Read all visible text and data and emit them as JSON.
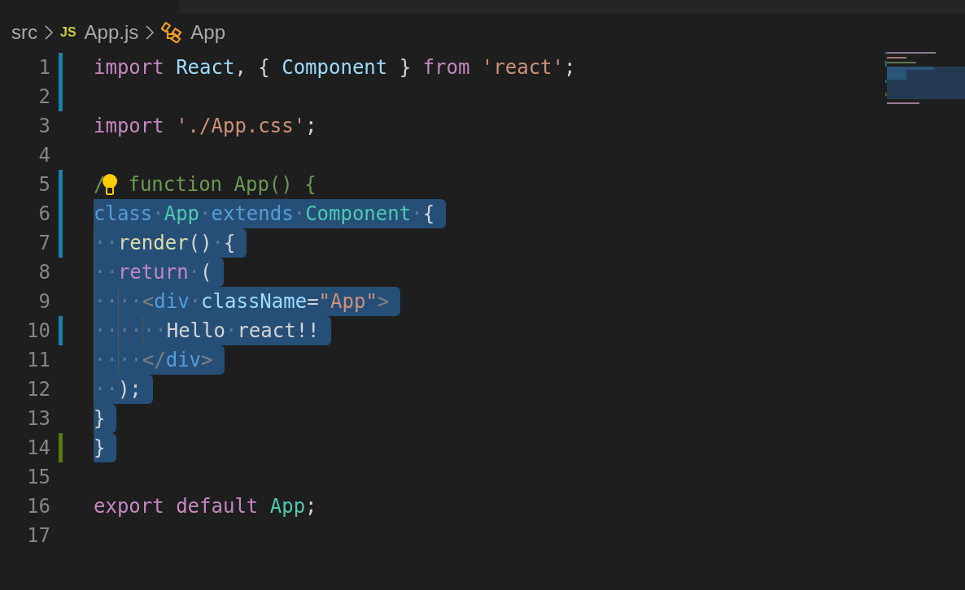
{
  "breadcrumb": [
    {
      "kind": "folder",
      "label": "src"
    },
    {
      "kind": "js-file",
      "badge": "JS",
      "label": "App.js"
    },
    {
      "kind": "symbol",
      "label": "App"
    }
  ],
  "lines": [
    {
      "number": "1",
      "kind": "modified",
      "selected": false,
      "tokens": [
        {
          "t": "import ",
          "kind": "control"
        },
        {
          "t": "React",
          "kind": "variable"
        },
        {
          "t": ", { ",
          "kind": "punct"
        },
        {
          "t": "Component",
          "kind": "variable"
        },
        {
          "t": " } ",
          "kind": "punct"
        },
        {
          "t": "from ",
          "kind": "control"
        },
        {
          "t": "'react'",
          "kind": "string"
        },
        {
          "t": ";",
          "kind": "punct"
        }
      ]
    },
    {
      "number": "2",
      "kind": "modified",
      "selected": false
    },
    {
      "number": "3",
      "kind": "plain",
      "selected": false,
      "tokens": [
        {
          "t": "import ",
          "kind": "control"
        },
        {
          "t": "'./App.css'",
          "kind": "string"
        },
        {
          "t": ";",
          "kind": "punct"
        }
      ]
    },
    {
      "number": "4",
      "kind": "plain",
      "selected": false
    },
    {
      "number": "5",
      "kind": "modified",
      "selected": false,
      "tokens": [
        {
          "t": "/",
          "kind": "comment"
        },
        {
          "kind": "bulb"
        },
        {
          "t": "function App() {",
          "kind": "comment"
        }
      ]
    },
    {
      "number": "6",
      "kind": "modified",
      "selected": true,
      "tokens": [
        {
          "t": "class",
          "kind": "storage"
        },
        {
          "t": "·",
          "kind": "ws"
        },
        {
          "t": "App",
          "kind": "class"
        },
        {
          "t": "·",
          "kind": "ws"
        },
        {
          "t": "extends",
          "kind": "storage"
        },
        {
          "t": "·",
          "kind": "ws"
        },
        {
          "t": "Component",
          "kind": "class"
        },
        {
          "t": "·",
          "kind": "ws"
        },
        {
          "t": "{",
          "kind": "punct"
        }
      ]
    },
    {
      "number": "7",
      "kind": "modified",
      "selected": true,
      "tokens": [
        {
          "t": "··",
          "kind": "ws",
          "guide": true
        },
        {
          "t": "render",
          "kind": "function"
        },
        {
          "t": "()",
          "kind": "punct"
        },
        {
          "t": "·",
          "kind": "ws"
        },
        {
          "t": "{",
          "kind": "punct"
        }
      ]
    },
    {
      "number": "8",
      "kind": "plain",
      "selected": true,
      "tokens": [
        {
          "t": "··",
          "kind": "ws",
          "guide": true
        },
        {
          "t": "return",
          "kind": "control"
        },
        {
          "t": "·",
          "kind": "ws"
        },
        {
          "t": "(",
          "kind": "punct"
        }
      ]
    },
    {
      "number": "9",
      "kind": "plain",
      "selected": true,
      "tokens": [
        {
          "t": "··",
          "kind": "ws",
          "guide": true
        },
        {
          "t": "··",
          "kind": "ws",
          "guide": true
        },
        {
          "t": "<",
          "kind": "bracket"
        },
        {
          "t": "div",
          "kind": "storage"
        },
        {
          "t": "·",
          "kind": "ws"
        },
        {
          "t": "className",
          "kind": "variable"
        },
        {
          "t": "=",
          "kind": "punct"
        },
        {
          "t": "\"App\"",
          "kind": "string"
        },
        {
          "t": ">",
          "kind": "bracket"
        }
      ]
    },
    {
      "number": "10",
      "kind": "modified",
      "selected": true,
      "tokens": [
        {
          "t": "··",
          "kind": "ws",
          "guide": true
        },
        {
          "t": "··",
          "kind": "ws",
          "guide": true
        },
        {
          "t": "··",
          "kind": "ws",
          "guide": true
        },
        {
          "t": "Hello",
          "kind": "punct"
        },
        {
          "t": "·",
          "kind": "ws"
        },
        {
          "t": "react!!",
          "kind": "punct"
        }
      ]
    },
    {
      "number": "11",
      "kind": "plain",
      "selected": true,
      "tokens": [
        {
          "t": "··",
          "kind": "ws",
          "guide": true
        },
        {
          "t": "··",
          "kind": "ws",
          "guide": true
        },
        {
          "t": "</",
          "kind": "bracket"
        },
        {
          "t": "div",
          "kind": "storage"
        },
        {
          "t": ">",
          "kind": "bracket"
        }
      ]
    },
    {
      "number": "12",
      "kind": "plain",
      "selected": true,
      "tokens": [
        {
          "t": "··",
          "kind": "ws",
          "guide": true
        },
        {
          "t": ");",
          "kind": "punct"
        }
      ]
    },
    {
      "number": "13",
      "kind": "plain",
      "selected": true,
      "tokens": [
        {
          "t": "}",
          "kind": "punct"
        }
      ]
    },
    {
      "number": "14",
      "kind": "added",
      "selected": true,
      "tokens": [
        {
          "t": "}",
          "kind": "punct"
        }
      ]
    },
    {
      "number": "15",
      "kind": "plain",
      "selected": false
    },
    {
      "number": "16",
      "kind": "plain",
      "selected": false,
      "tokens": [
        {
          "t": "export ",
          "kind": "control"
        },
        {
          "t": "default ",
          "kind": "control"
        },
        {
          "t": "App",
          "kind": "class"
        },
        {
          "t": ";",
          "kind": "punct"
        }
      ]
    },
    {
      "number": "17",
      "kind": "plain",
      "selected": false
    }
  ]
}
